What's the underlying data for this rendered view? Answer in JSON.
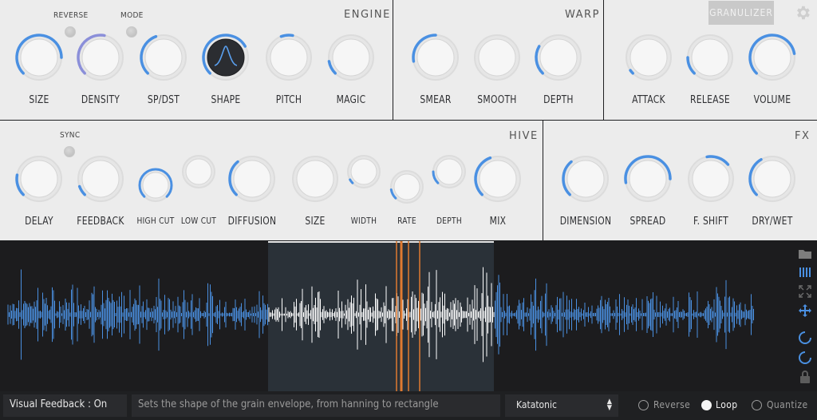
{
  "sections": {
    "engine": "ENGINE",
    "warp": "WARP",
    "hive": "HIVE",
    "fx": "FX"
  },
  "toggles": {
    "reverse": "REVERSE",
    "mode": "MODE",
    "sync": "SYNC"
  },
  "header": {
    "granulizer": "GRANULIZER"
  },
  "knobs": {
    "size": "SIZE",
    "density": "DENSITY",
    "sp_dst": "SP/DST",
    "shape": "SHAPE",
    "pitch": "PITCH",
    "magic": "MAGIC",
    "smear": "SMEAR",
    "smooth": "SMOOTH",
    "depth": "DEPTH",
    "attack": "ATTACK",
    "release": "RELEASE",
    "volume": "VOLUME",
    "delay": "DELAY",
    "feedback": "FEEDBACK",
    "high_cut": "HIGH CUT",
    "low_cut": "LOW CUT",
    "diffusion": "DIFFUSION",
    "hive_size": "SIZE",
    "width": "WIDTH",
    "rate": "RATE",
    "hive_depth": "DEPTH",
    "mix": "MIX",
    "dimension": "DIMENSION",
    "spread": "SPREAD",
    "f_shift": "F. SHIFT",
    "dry_wet": "DRY/WET"
  },
  "bottom": {
    "visual_feedback": "Visual Feedback : On",
    "description": "Sets the shape of the grain envelope, from hanning to rectangle",
    "preset": "Katatonic",
    "reverse": "Reverse",
    "loop": "Loop",
    "quantize": "Quantize"
  },
  "colors": {
    "accent": "#4a90e2",
    "density_accent": "#8b8fd9",
    "selection": "#2a3138",
    "playhead": "#e07a30"
  }
}
